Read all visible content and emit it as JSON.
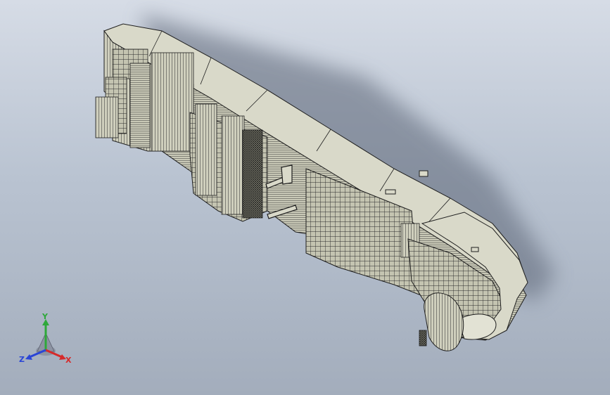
{
  "viewport": {
    "background_top": "#d6dce6",
    "background_bottom": "#a3adbc",
    "model": {
      "name": "ship-hull-assembly",
      "hull_color": "#d9d9c9",
      "edge_color": "#1e1e1e"
    }
  },
  "triad": {
    "x_label": "X",
    "y_label": "Y",
    "z_label": "Z",
    "x_color": "#d62a2a",
    "y_color": "#2ea83a",
    "z_color": "#2a45d6"
  }
}
